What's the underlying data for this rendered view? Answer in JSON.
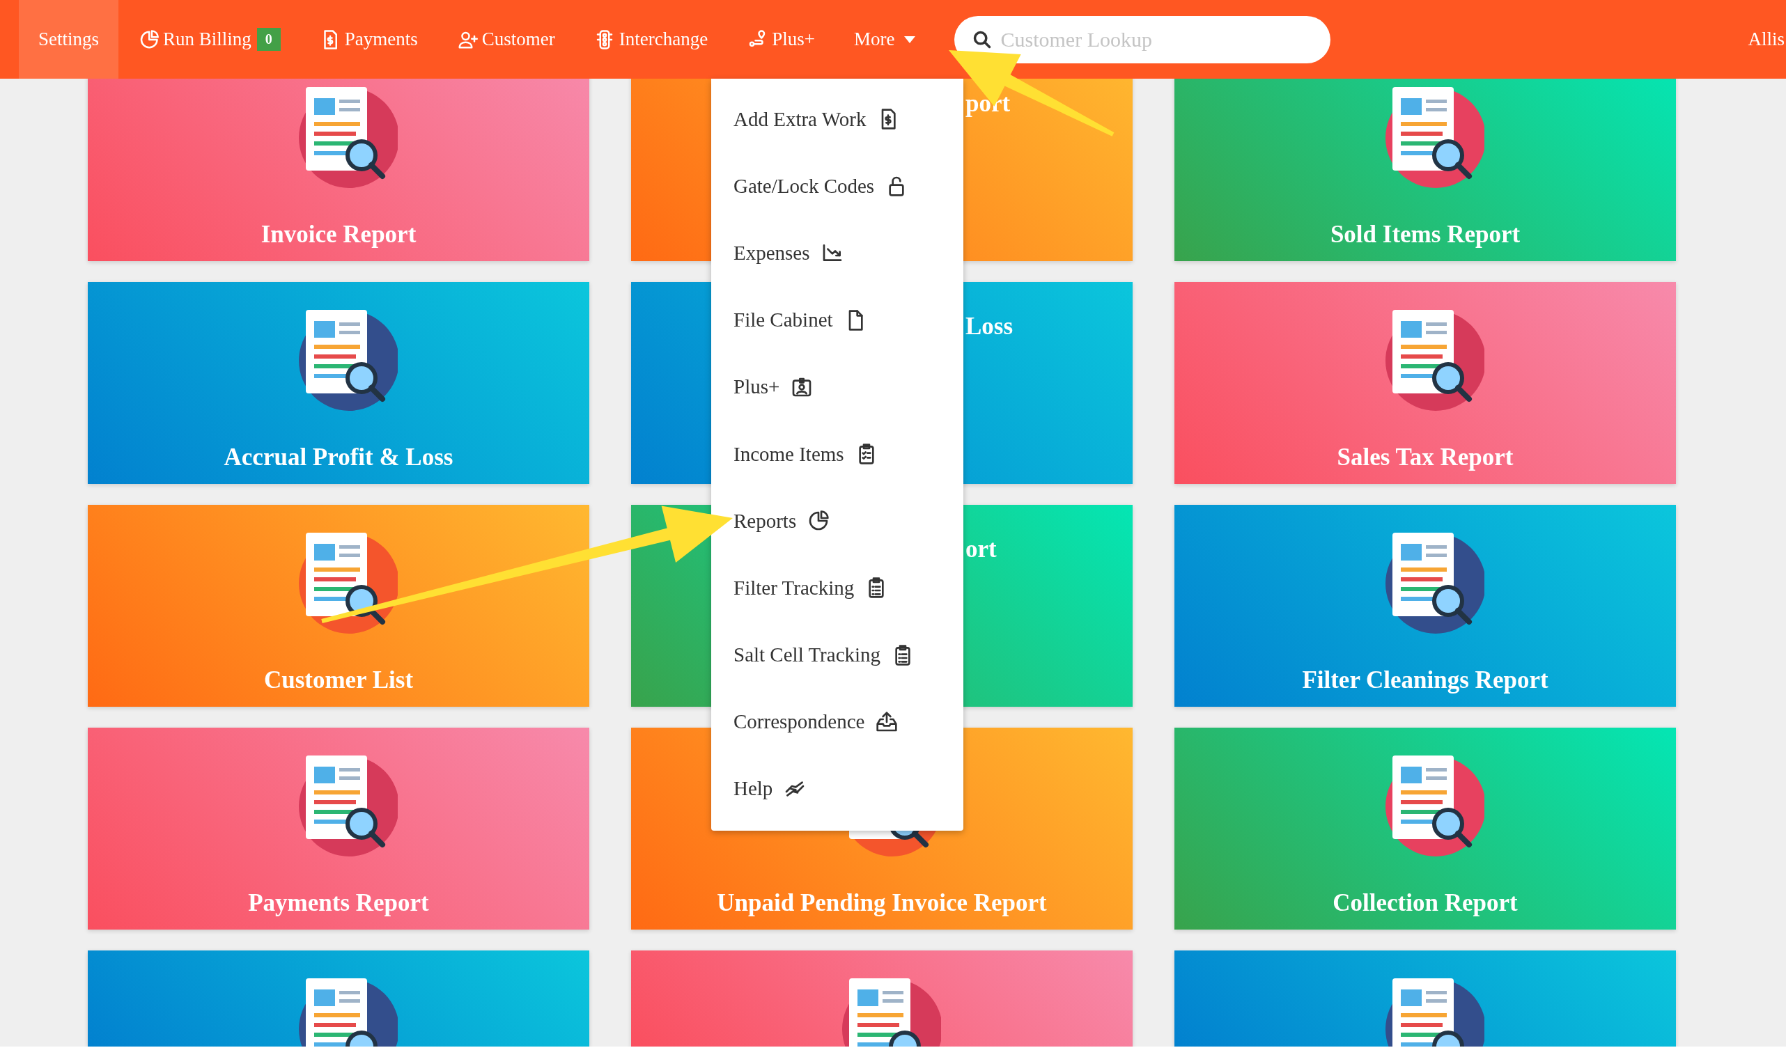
{
  "nav": {
    "items": [
      {
        "label": "Settings",
        "selected": true
      },
      {
        "label": "Run Billing",
        "selected": false,
        "badge": "0"
      },
      {
        "label": "Payments",
        "selected": false
      },
      {
        "label": "Customer",
        "selected": false
      },
      {
        "label": "Interchange",
        "selected": false
      },
      {
        "label": "Plus+",
        "selected": false
      },
      {
        "label": "More",
        "selected": false,
        "dropdown": true
      }
    ],
    "search": {
      "placeholder": "Customer Lookup"
    },
    "user": "Allis"
  },
  "cards": [
    {
      "title": "Invoice Report",
      "color": "#f9566a"
    },
    {
      "title": "port",
      "color": "#ff7a1c",
      "partial": true
    },
    {
      "title": "Sold Items Report",
      "color": "#36a852"
    },
    {
      "title": "Accrual Profit & Loss",
      "color": "#0288d1"
    },
    {
      "title": "Loss",
      "color": "#0288d1",
      "partial": true
    },
    {
      "title": "Sales Tax Report",
      "color": "#f9566a"
    },
    {
      "title": "Customer List",
      "color": "#ff7a1c"
    },
    {
      "title": "ort",
      "color": "#36a852",
      "partial": true
    },
    {
      "title": "Filter Cleanings Report",
      "color": "#0288d1"
    },
    {
      "title": "Payments Report",
      "color": "#f9566a"
    },
    {
      "title": "Unpaid Pending Invoice Report",
      "color": "#ff7a1c"
    },
    {
      "title": "Collection Report",
      "color": "#36a852"
    },
    {
      "color": "#0288d1"
    },
    {
      "color": "#f9566a"
    },
    {
      "color": "#0288d1"
    }
  ],
  "menu": {
    "items": [
      "Add Extra Work",
      "Gate/Lock Codes",
      "Expenses",
      "File Cabinet",
      "Plus+",
      "Income Items",
      "Reports",
      "Filter Tracking",
      "Salt Cell Tracking",
      "Correspondence",
      "Help"
    ]
  }
}
